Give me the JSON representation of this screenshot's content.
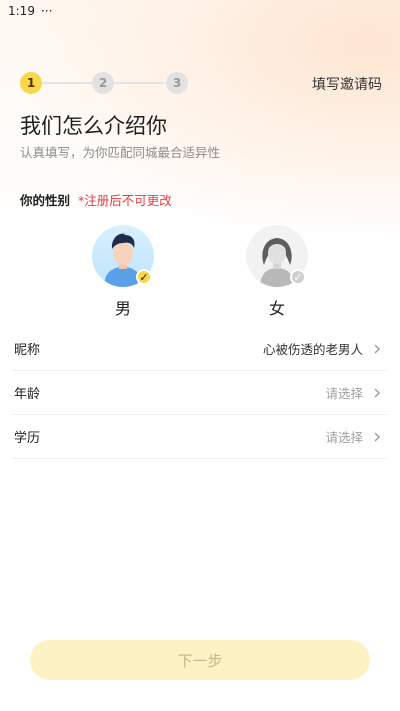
{
  "status_bar": {
    "time": "1:19",
    "overflow": "···"
  },
  "steps": [
    {
      "number": "1",
      "active": true
    },
    {
      "number": "2",
      "active": false
    },
    {
      "number": "3",
      "active": false
    }
  ],
  "header": {
    "invite_code_label": "填写邀请码"
  },
  "page": {
    "title": "我们怎么介绍你",
    "subtitle": "认真填写，为你匹配同城最合适异性"
  },
  "gender": {
    "heading": "你的性别",
    "note": "*注册后不可更改",
    "options": [
      {
        "label": "男",
        "selected": true
      },
      {
        "label": "女",
        "selected": false
      }
    ]
  },
  "form": {
    "rows": [
      {
        "label": "昵称",
        "value": "心被伤透的老男人",
        "is_placeholder": false
      },
      {
        "label": "年龄",
        "value": "请选择",
        "is_placeholder": true
      },
      {
        "label": "学历",
        "value": "请选择",
        "is_placeholder": true
      }
    ]
  },
  "footer": {
    "next_label": "下一步"
  },
  "colors": {
    "accent": "#f9d64a",
    "warning": "#f0383a",
    "button_disabled_bg": "#fdf2c3"
  }
}
